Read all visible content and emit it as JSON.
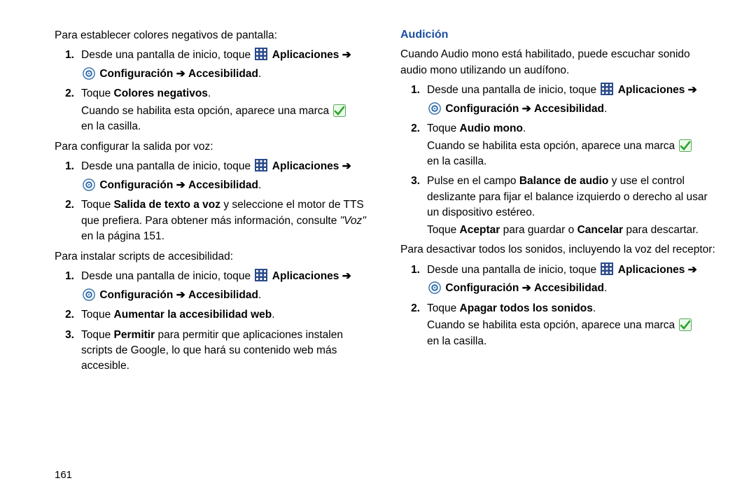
{
  "page_number": "161",
  "left": {
    "intro1": "Para establecer colores negativos de pantalla:",
    "step1_a": "Desde una pantalla de inicio, toque",
    "apps": "Aplicaciones",
    "arrow": "➔",
    "config": "Configuración",
    "access": "Accesibilidad",
    "step2_a_pre": "Toque",
    "step2_a_bold": "Colores negativos",
    "step2_a_sub1": "Cuando se habilita esta opción, aparece una marca",
    "step2_a_sub2": "en la casilla.",
    "intro2": "Para configurar la salida por voz:",
    "step2_b_pre": "Toque",
    "step2_b_bold": "Salida de texto a voz",
    "step2_b_rest": " y seleccione el motor de TTS que prefiera. Para obtener más información, consulte ",
    "step2_b_link": "\"Voz\"",
    "step2_b_page": " en la página 151.",
    "intro3": "Para instalar scripts de accesibilidad:",
    "step2_c_pre": "Toque",
    "step2_c_bold": "Aumentar la accesibilidad web",
    "step3_c_pre": "Toque",
    "step3_c_bold": "Permitir",
    "step3_c_rest": " para permitir que aplicaciones instalen scripts de Google, lo que hará su contenido web más accesible."
  },
  "right": {
    "heading": "Audición",
    "intro": "Cuando Audio mono está habilitado, puede escuchar sonido audio mono utilizando un audífono.",
    "step1_a": "Desde una pantalla de inicio, toque",
    "apps": "Aplicaciones",
    "arrow": "➔",
    "config": "Configuración",
    "access": "Accesibilidad",
    "step2_a_pre": "Toque",
    "step2_a_bold": "Audio mono",
    "step2_a_sub1": "Cuando se habilita esta opción, aparece una marca",
    "step2_a_sub2": "en la casilla.",
    "step3_a_pre": "Pulse en el campo",
    "step3_a_bold": "Balance de audio",
    "step3_a_rest": " y use el control deslizante para fijar el balance izquierdo o derecho al usar un dispositivo estéreo.",
    "step3_a_line2_pre": "Toque",
    "step3_a_line2_b1": "Aceptar",
    "step3_a_line2_mid": " para guardar o ",
    "step3_a_line2_b2": "Cancelar",
    "step3_a_line2_end": " para descartar.",
    "intro2": "Para desactivar todos los sonidos, incluyendo la voz del receptor:",
    "step2_b_pre": "Toque",
    "step2_b_bold": "Apagar todos los sonidos",
    "step2_b_sub1": "Cuando se habilita esta opción, aparece una marca",
    "step2_b_sub2": "en la casilla."
  }
}
